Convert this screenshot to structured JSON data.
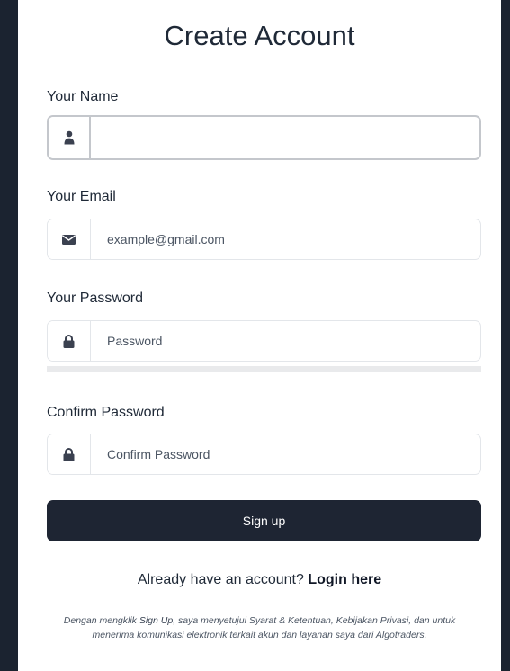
{
  "form": {
    "title": "Create Account",
    "name": {
      "label": "Your Name",
      "value": "",
      "placeholder": ""
    },
    "email": {
      "label": "Your Email",
      "value": "",
      "placeholder": "example@gmail.com"
    },
    "password": {
      "label": "Your Password",
      "value": "",
      "placeholder": "Password"
    },
    "confirm": {
      "label": "Confirm Password",
      "value": "",
      "placeholder": "Confirm Password"
    },
    "signup_label": "Sign up",
    "login_prompt": "Already have an account?",
    "login_link": "Login here",
    "disclaimer": {
      "pre": "Dengan mengklik ",
      "action": "Sign Up",
      "post": ", saya menyetujui Syarat & Ketentuan, Kebijakan Privasi, dan untuk menerima komunikasi elektronik terkait akun dan layanan saya dari Algotraders."
    }
  },
  "icons": {
    "name": "user-icon",
    "email": "envelope-icon",
    "password": "lock-icon",
    "confirm": "lock-icon"
  },
  "colors": {
    "background": "#1b2330",
    "button": "#1e2533",
    "border": "#e3e6ea",
    "active_border": "#c4c7cc"
  }
}
